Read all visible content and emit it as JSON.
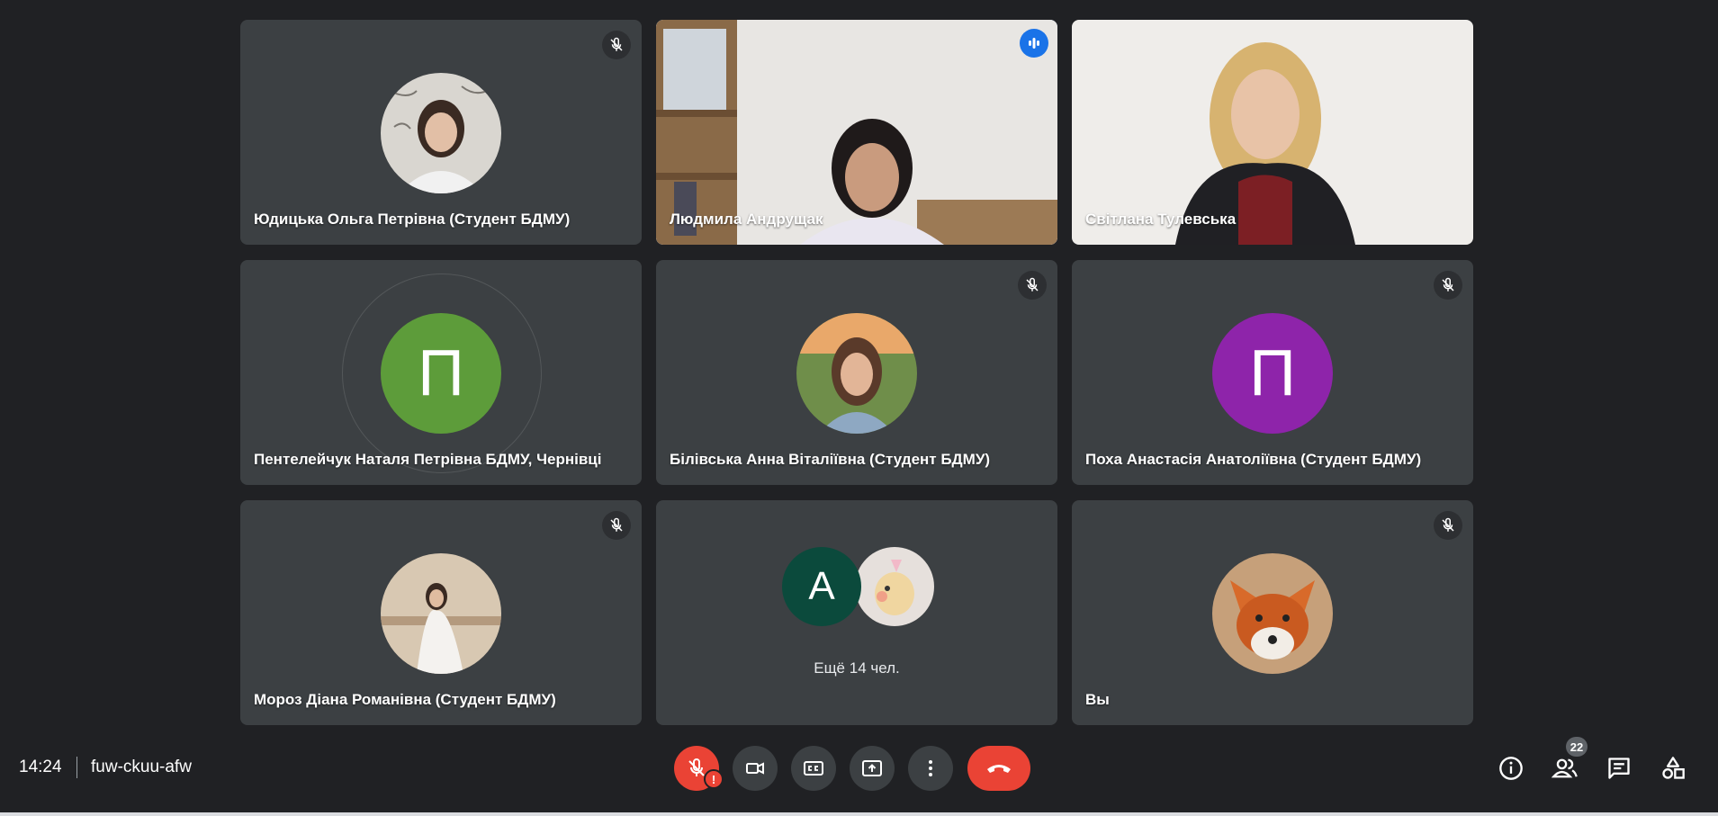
{
  "participants": [
    {
      "name": "Юдицька Ольга Петрівна (Студент БДМУ)",
      "muted": true
    },
    {
      "name": "Людмила Андрущак",
      "speaking": true
    },
    {
      "name": "Світлана Тулевська"
    },
    {
      "name": "Пентелейчук Наталя Петрівна БДМУ, Чернівці",
      "initial": "П",
      "color": "#5d9c3a"
    },
    {
      "name": "Білівська Анна Віталіївна (Студент БДМУ)",
      "muted": true
    },
    {
      "name": "Поха Анастасія Анатоліївна (Студент БДМУ)",
      "initial": "П",
      "color": "#8e24aa",
      "muted": true
    },
    {
      "name": "Мороз Діана Романівна (Студент БДМУ)",
      "muted": true
    },
    {
      "more_initial": "А",
      "more_label": "Ещё 14 чел.",
      "color": "#0b4a3c"
    },
    {
      "name": "Вы",
      "muted": true
    }
  ],
  "bottom_bar": {
    "time": "14:24",
    "meeting_code": "fuw-ckuu-afw",
    "mic_alert": "!",
    "people_count": "22"
  },
  "colors": {
    "background": "#202124",
    "tile": "#3c4043",
    "speaking_outline": "#8ab4f8",
    "red": "#ea4335",
    "speaking_badge": "#1a73e8"
  },
  "icons": [
    "mic-off-icon",
    "audio-level-icon",
    "camera-icon",
    "captions-icon",
    "present-icon",
    "more-vert-icon",
    "call-end-icon",
    "info-icon",
    "people-icon",
    "chat-icon",
    "activities-icon"
  ]
}
